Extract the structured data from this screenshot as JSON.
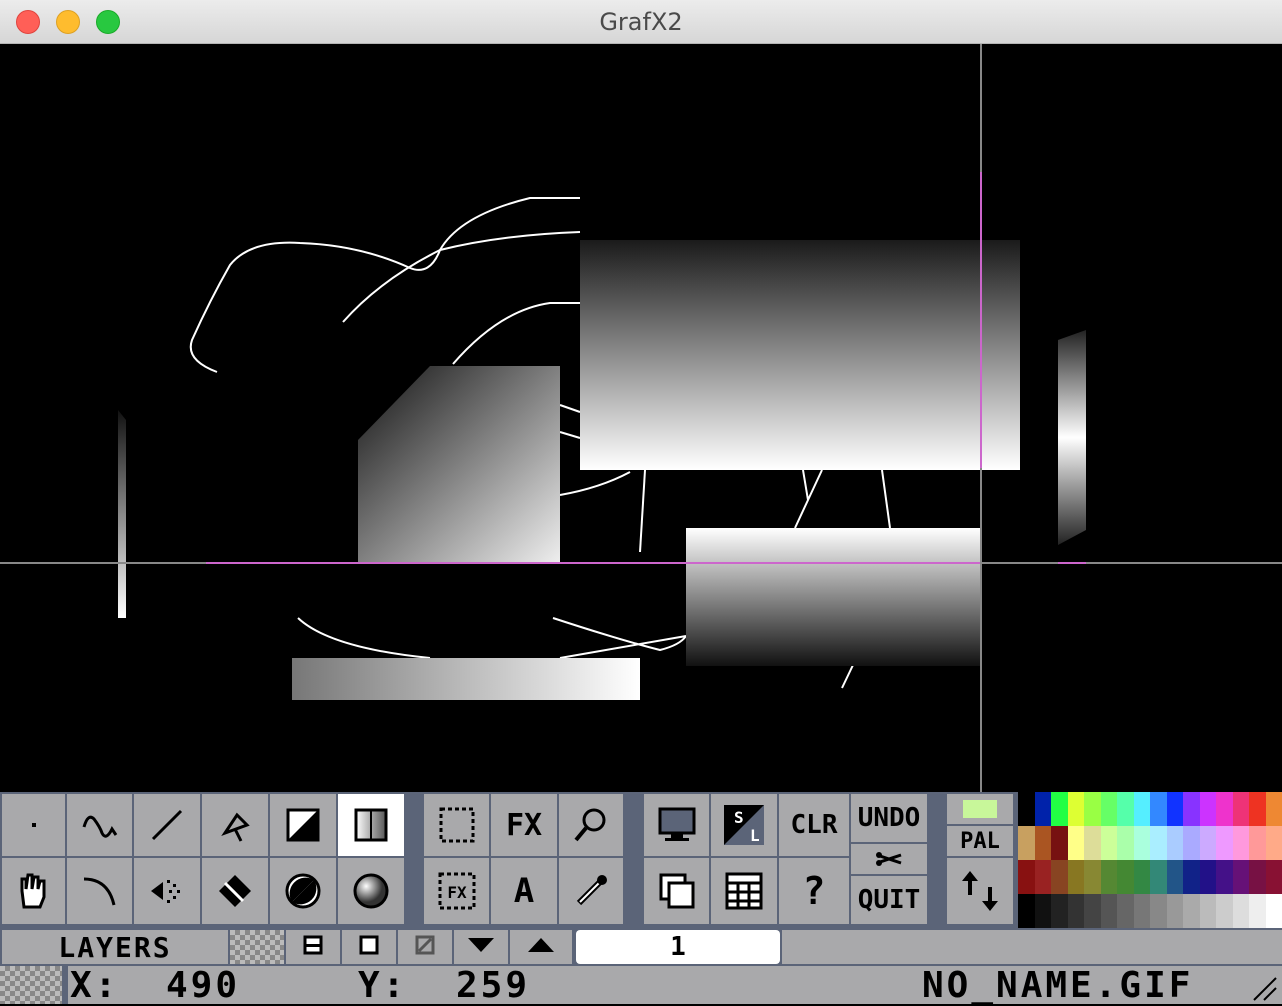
{
  "window": {
    "title": "GrafX2"
  },
  "tools": {
    "row1": [
      {
        "name": "freehand-dot-tool",
        "icon": "dot-icon"
      },
      {
        "name": "curve-freehand-tool",
        "icon": "squiggle-icon"
      },
      {
        "name": "line-tool",
        "icon": "line-icon"
      },
      {
        "name": "spray-tool",
        "icon": "spray-icon"
      },
      {
        "name": "filled-rect-tool",
        "icon": "half-square-icon"
      },
      {
        "name": "gradient-rect-tool",
        "icon": "gradient-square-icon",
        "selected": true
      }
    ],
    "row2": [
      {
        "name": "hand-tool",
        "icon": "hand-icon"
      },
      {
        "name": "bezier-tool",
        "icon": "curve-icon"
      },
      {
        "name": "airbrush-tool",
        "icon": "airbrush-icon"
      },
      {
        "name": "fill-tool",
        "icon": "bucket-icon"
      },
      {
        "name": "circle-tool",
        "icon": "half-circle-icon"
      },
      {
        "name": "sphere-tool",
        "icon": "sphere-icon"
      }
    ],
    "fx_label": "FX",
    "text_label": "A",
    "help_label": "?",
    "clr_label": "CLR",
    "undo_label": "UNDO",
    "quit_label": "QUIT",
    "pal_label": "PAL",
    "fore_color": "#c8f79a"
  },
  "layers": {
    "label": "LAYERS",
    "current": "1"
  },
  "status": {
    "x_label": "X:",
    "x_value": "490",
    "y_label": "Y:",
    "y_value": "259",
    "filename": "NO_NAME.GIF"
  },
  "palette": {
    "row1": [
      "#000000",
      "#0022aa",
      "#22ff44",
      "#ddff33",
      "#99ff44",
      "#66ff66",
      "#55ffaa",
      "#55eeff",
      "#3388ff",
      "#1133ff",
      "#8833ff",
      "#cc33ff",
      "#ee33cc",
      "#ee3377",
      "#ee3322",
      "#ee8833"
    ],
    "row2": [
      "#c8a060",
      "#aa5522",
      "#771111",
      "#ffff88",
      "#dddd99",
      "#ccff99",
      "#aaffaa",
      "#aaffdd",
      "#aaeeff",
      "#aaccff",
      "#aaaaff",
      "#ccaaff",
      "#ee99ff",
      "#ff99dd",
      "#ff9999",
      "#ffaa88"
    ],
    "row3": [
      "#881111",
      "#992222",
      "#884422",
      "#887722",
      "#888833",
      "#558833",
      "#448833",
      "#338844",
      "#338877",
      "#225588",
      "#112288",
      "#221188",
      "#441188",
      "#661177",
      "#771144",
      "#881133"
    ],
    "row4": [
      "#000000",
      "#111111",
      "#222222",
      "#333333",
      "#444444",
      "#555555",
      "#666666",
      "#777777",
      "#888888",
      "#999999",
      "#aaaaaa",
      "#bbbbbb",
      "#cccccc",
      "#dddddd",
      "#eeeeee",
      "#ffffff"
    ]
  }
}
